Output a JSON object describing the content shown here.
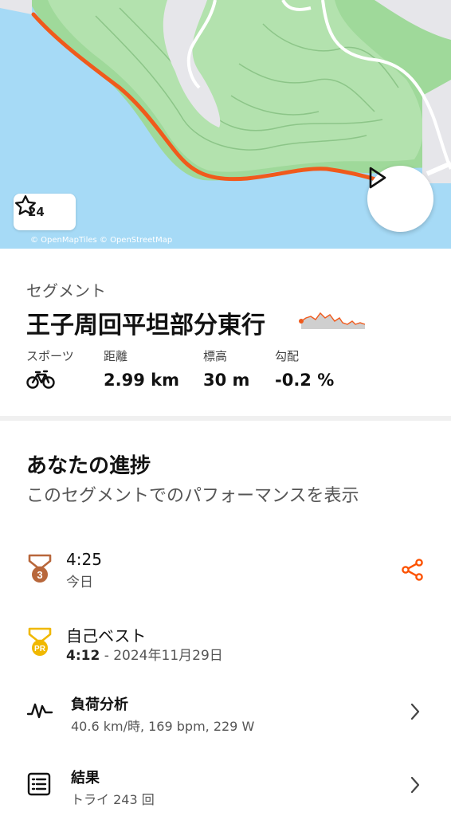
{
  "map": {
    "star_count": "24",
    "attribution": "© OpenMapTiles © OpenStreetMap",
    "colors": {
      "water": "#a6daf6",
      "land": "#9fd99a",
      "route": "#f05a1c"
    }
  },
  "segment": {
    "label": "セグメント",
    "title": "王子周回平坦部分東行",
    "stats": [
      {
        "label": "スポーツ",
        "value": ""
      },
      {
        "label": "距離",
        "value": "2.99 km"
      },
      {
        "label": "標高",
        "value": "30 m"
      },
      {
        "label": "勾配",
        "value": "-0.2 %"
      }
    ]
  },
  "progress": {
    "title": "あなたの進捗",
    "subtitle": "このセグメントでのパフォーマンスを表示"
  },
  "rows": {
    "recent": {
      "time": "4:25",
      "date": "今日",
      "rank": "3"
    },
    "pr": {
      "title": "自己ベスト",
      "time": "4:12",
      "date": " - 2024年11月29日",
      "badge": "PR"
    },
    "analysis": {
      "title": "負荷分析",
      "detail": "40.6 km/時, 169 bpm, 229 W"
    },
    "results": {
      "title": "結果",
      "detail": "トライ 243 回"
    }
  },
  "colors": {
    "accent": "#fc5200",
    "bronze": "#b8673b",
    "gold": "#f0b800"
  }
}
